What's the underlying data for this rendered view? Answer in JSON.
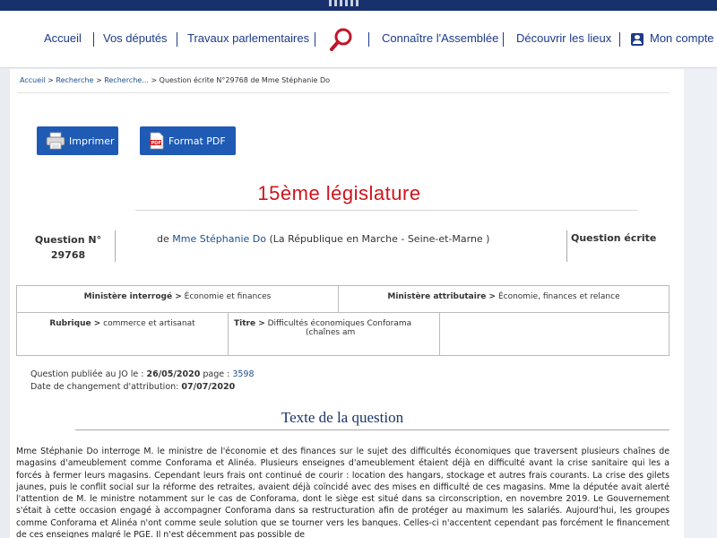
{
  "nav": {
    "items": [
      "Accueil",
      "Vos députés",
      "Travaux parlementaires",
      "Connaître l'Assemblée",
      "Découvrir les lieux"
    ],
    "account_label": "Mon compte"
  },
  "breadcrumb": {
    "items": [
      "Accueil",
      "Recherche",
      "Recherche..."
    ],
    "current": "Question écrite N°29768 de Mme Stéphanie Do"
  },
  "toolbar": {
    "print_label": "Imprimer",
    "pdf_label": "Format PDF"
  },
  "legislature": "15ème législature",
  "question": {
    "number_label": "Question N°",
    "number": "29768",
    "author_prefix": "de",
    "author_name": "Mme Stéphanie Do",
    "author_group": "(La République en Marche - Seine-et-Marne )",
    "type": "Question écrite"
  },
  "details": {
    "ministere_interroge_label": "Ministère interrogé >",
    "ministere_interroge_value": "Économie et finances",
    "ministere_attributaire_label": "Ministère attributaire >",
    "ministere_attributaire_value": "Économie, finances et relance",
    "rubrique_label": "Rubrique >",
    "rubrique_value": "commerce et artisanat",
    "titre_label": "Titre >",
    "titre_value_line1": "Difficultés économiques Conforama",
    "titre_value_line2": "(chaînes am"
  },
  "publication": {
    "published_label": "Question publiée au JO le :",
    "published_date": "26/05/2020",
    "page_label": "page :",
    "page_number": "3598",
    "change_label": "Date de changement d'attribution:",
    "change_date": "07/07/2020"
  },
  "section_title": "Texte de la question",
  "question_text": "Mme Stéphanie Do interroge M. le ministre de l'économie et des finances sur le sujet des difficultés économiques que traversent plusieurs chaînes de magasins d'ameublement comme Conforama et Alinéa. Plusieurs enseignes d'ameublement étaient déjà en difficulté avant la crise sanitaire qui les a forcés à fermer leurs magasins. Cependant leurs frais ont continué de courir : location des hangars, stockage et autres frais courants. La crise des gilets jaunes, puis le conflit social sur la réforme des retraites, avaient déjà coïncidé avec des mises en difficulté de ces magasins. Mme la députée avait alerté l'attention de M. le ministre notamment sur le cas de Conforama, dont le siège est situé dans sa circonscription, en novembre 2019. Le Gouvernement s'était à cette occasion engagé à accompagner Conforama dans sa restructuration afin de protéger au maximum les salariés. Aujourd'hui, les groupes comme Conforama et Alinéa n'ont comme seule solution que se tourner vers les banques. Celles-ci n'accentent cependant pas forcément le financement de ces enseignes malgré le PGE. Il n'est décemment pas possible de",
  "colors": {
    "nav_blue": "#1e3a8a",
    "button_blue": "#1f5ab5",
    "legislature_red": "#d0141b",
    "search_red": "#c0162a",
    "link_blue": "#1e4f8f"
  }
}
